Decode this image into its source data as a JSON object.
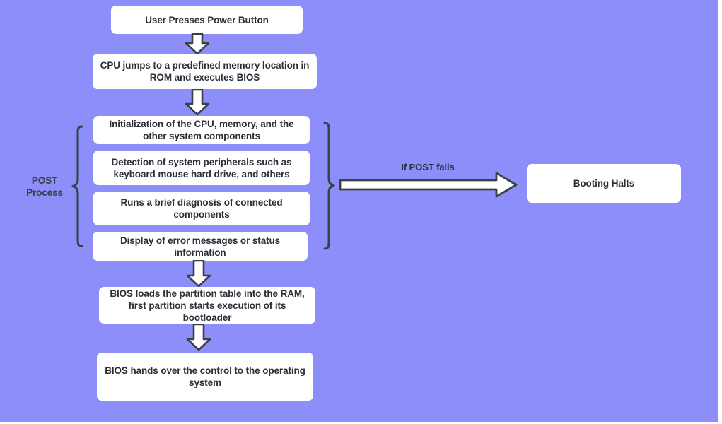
{
  "diagram": {
    "title": "Computer Boot / BIOS POST Process Flowchart",
    "background_color": "#8e8efb",
    "node_fill": "#ffffff",
    "node_stroke": "#3b3f46",
    "text_color": "#2b2f36"
  },
  "nodes": {
    "power_button": "User Presses Power Button",
    "cpu_jump": "CPU jumps to a predefined memory location in ROM and executes BIOS",
    "post_init": "Initialization of the CPU, memory, and the other system components",
    "post_detect": "Detection of system peripherals such as keyboard mouse hard drive, and others",
    "post_diagnosis": "Runs a brief diagnosis of connected components",
    "post_display": "Display of error messages or status information",
    "bios_partition": "BIOS loads the partition table into the RAM, first partition starts execution of its bootloader",
    "bios_handover": "BIOS hands over the control to the operating system",
    "booting_halts": "Booting Halts"
  },
  "labels": {
    "post_process_line1": "POST",
    "post_process_line2": "Process",
    "if_post_fails": "If POST fails"
  },
  "icons": {
    "arrow_down": "arrow-down-icon",
    "arrow_right": "arrow-right-icon",
    "brace_left": "curly-brace-left-icon",
    "brace_right": "curly-brace-right-icon"
  }
}
